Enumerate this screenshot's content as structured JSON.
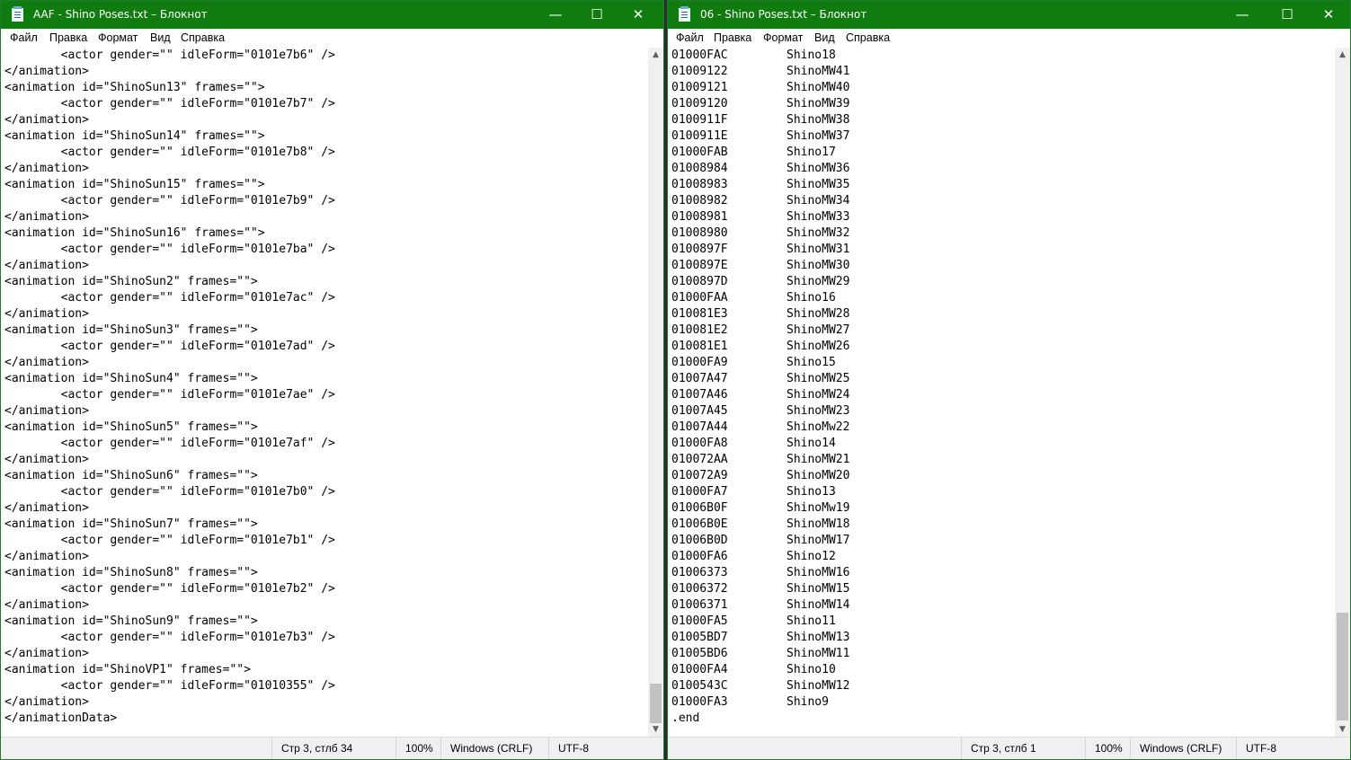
{
  "left": {
    "title": "AAF - Shino Poses.txt – Блокнот",
    "menu": [
      "Файл",
      "Правка",
      "Формат",
      "Вид",
      "Справка"
    ],
    "lines": [
      "        <actor gender=\"\" idleForm=\"0101e7b6\" />",
      "</animation>",
      "<animation id=\"ShinoSun13\" frames=\"\">",
      "        <actor gender=\"\" idleForm=\"0101e7b7\" />",
      "</animation>",
      "<animation id=\"ShinoSun14\" frames=\"\">",
      "        <actor gender=\"\" idleForm=\"0101e7b8\" />",
      "</animation>",
      "<animation id=\"ShinoSun15\" frames=\"\">",
      "        <actor gender=\"\" idleForm=\"0101e7b9\" />",
      "</animation>",
      "<animation id=\"ShinoSun16\" frames=\"\">",
      "        <actor gender=\"\" idleForm=\"0101e7ba\" />",
      "</animation>",
      "<animation id=\"ShinoSun2\" frames=\"\">",
      "        <actor gender=\"\" idleForm=\"0101e7ac\" />",
      "</animation>",
      "<animation id=\"ShinoSun3\" frames=\"\">",
      "        <actor gender=\"\" idleForm=\"0101e7ad\" />",
      "</animation>",
      "<animation id=\"ShinoSun4\" frames=\"\">",
      "        <actor gender=\"\" idleForm=\"0101e7ae\" />",
      "</animation>",
      "<animation id=\"ShinoSun5\" frames=\"\">",
      "        <actor gender=\"\" idleForm=\"0101e7af\" />",
      "</animation>",
      "<animation id=\"ShinoSun6\" frames=\"\">",
      "        <actor gender=\"\" idleForm=\"0101e7b0\" />",
      "</animation>",
      "<animation id=\"ShinoSun7\" frames=\"\">",
      "        <actor gender=\"\" idleForm=\"0101e7b1\" />",
      "</animation>",
      "<animation id=\"ShinoSun8\" frames=\"\">",
      "        <actor gender=\"\" idleForm=\"0101e7b2\" />",
      "</animation>",
      "<animation id=\"ShinoSun9\" frames=\"\">",
      "        <actor gender=\"\" idleForm=\"0101e7b3\" />",
      "</animation>",
      "<animation id=\"ShinoVP1\" frames=\"\">",
      "        <actor gender=\"\" idleForm=\"01010355\" />",
      "</animation>",
      "</animationData>"
    ],
    "status": {
      "position": "Стр 3, стлб 34",
      "zoom": "100%",
      "line_ending": "Windows (CRLF)",
      "encoding": "UTF-8"
    }
  },
  "right": {
    "title": "06 - Shino Poses.txt – Блокнот",
    "menu": [
      "Файл",
      "Правка",
      "Формат",
      "Вид",
      "Справка"
    ],
    "rows": [
      [
        "01000FAC",
        "Shino18"
      ],
      [
        "01009122",
        "ShinoMW41"
      ],
      [
        "01009121",
        "ShinoMW40"
      ],
      [
        "01009120",
        "ShinoMW39"
      ],
      [
        "0100911F",
        "ShinoMW38"
      ],
      [
        "0100911E",
        "ShinoMW37"
      ],
      [
        "01000FAB",
        "Shino17"
      ],
      [
        "01008984",
        "ShinoMW36"
      ],
      [
        "01008983",
        "ShinoMW35"
      ],
      [
        "01008982",
        "ShinoMW34"
      ],
      [
        "01008981",
        "ShinoMW33"
      ],
      [
        "01008980",
        "ShinoMW32"
      ],
      [
        "0100897F",
        "ShinoMW31"
      ],
      [
        "0100897E",
        "ShinoMW30"
      ],
      [
        "0100897D",
        "ShinoMW29"
      ],
      [
        "01000FAA",
        "Shino16"
      ],
      [
        "010081E3",
        "ShinoMW28"
      ],
      [
        "010081E2",
        "ShinoMW27"
      ],
      [
        "010081E1",
        "ShinoMW26"
      ],
      [
        "01000FA9",
        "Shino15"
      ],
      [
        "01007A47",
        "ShinoMW25"
      ],
      [
        "01007A46",
        "ShinoMW24"
      ],
      [
        "01007A45",
        "ShinoMW23"
      ],
      [
        "01007A44",
        "ShinoMw22"
      ],
      [
        "01000FA8",
        "Shino14"
      ],
      [
        "010072AA",
        "ShinoMW21"
      ],
      [
        "010072A9",
        "ShinoMW20"
      ],
      [
        "01000FA7",
        "Shino13"
      ],
      [
        "01006B0F",
        "ShinoMw19"
      ],
      [
        "01006B0E",
        "ShinoMW18"
      ],
      [
        "01006B0D",
        "ShinoMW17"
      ],
      [
        "01000FA6",
        "Shino12"
      ],
      [
        "01006373",
        "ShinoMW16"
      ],
      [
        "01006372",
        "ShinoMW15"
      ],
      [
        "01006371",
        "ShinoMW14"
      ],
      [
        "01000FA5",
        "Shino11"
      ],
      [
        "01005BD7",
        "ShinoMW13"
      ],
      [
        "01005BD6",
        "ShinoMW11"
      ],
      [
        "01000FA4",
        "Shino10"
      ],
      [
        "0100543C",
        "ShinoMW12"
      ],
      [
        "01000FA3",
        "Shino9"
      ]
    ],
    "end_line": ".end",
    "status": {
      "position": "Стр 3, стлб 1",
      "zoom": "100%",
      "line_ending": "Windows (CRLF)",
      "encoding": "UTF-8"
    }
  },
  "window_buttons": {
    "minimize": "—",
    "maximize": "☐",
    "close": "✕"
  },
  "icons": {
    "app": "notepad-icon"
  },
  "colors": {
    "titlebar": "#107c10",
    "statusbar": "#f0f0f0"
  }
}
